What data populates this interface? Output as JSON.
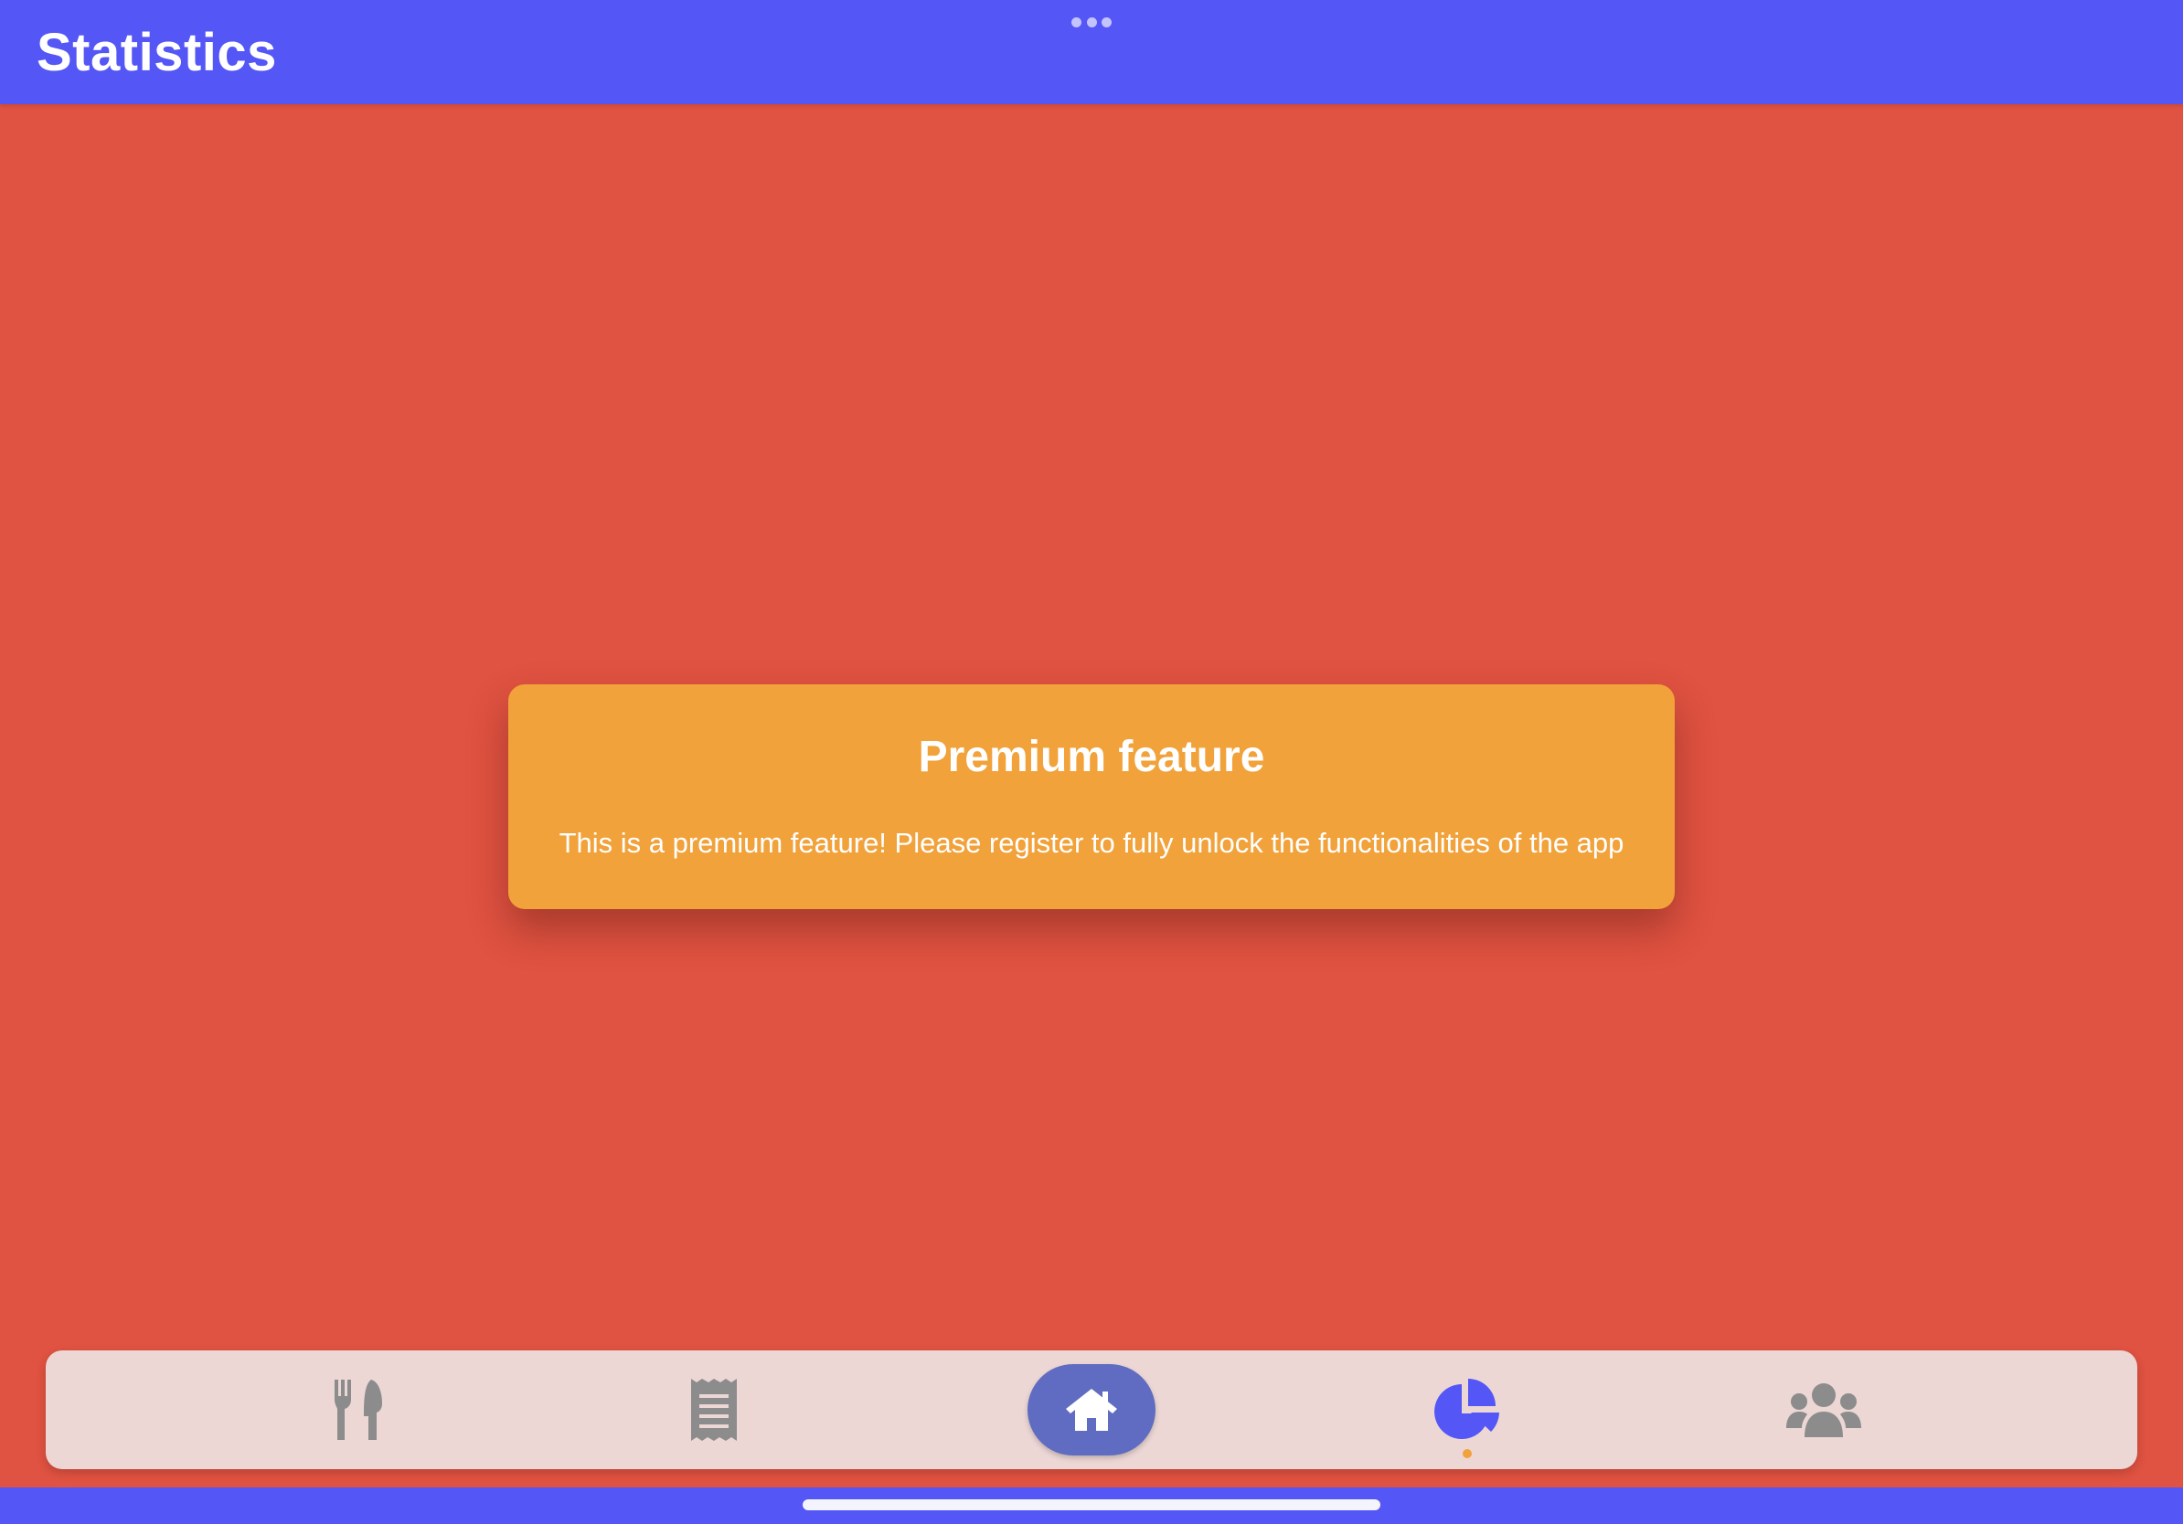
{
  "header": {
    "title": "Statistics"
  },
  "premium_dialog": {
    "title": "Premium feature",
    "message": "This is a premium feature! Please register to fully unlock the functionalities of the app"
  },
  "tab_bar": {
    "items": [
      {
        "icon": "fork-knife-icon",
        "active": false
      },
      {
        "icon": "receipt-icon",
        "active": false
      },
      {
        "icon": "home-icon",
        "active": false,
        "highlighted": true
      },
      {
        "icon": "pie-chart-icon",
        "active": true
      },
      {
        "icon": "users-icon",
        "active": false
      }
    ]
  },
  "colors": {
    "header_bg": "#5456f5",
    "page_bg": "#e05241",
    "card_bg": "#f1a23b",
    "tabbar_bg": "#ecd7d5",
    "home_pill": "#5f6cc1",
    "active_icon": "#5456f5",
    "inactive_icon": "#8c8c8c",
    "active_dot": "#f1a23b"
  }
}
